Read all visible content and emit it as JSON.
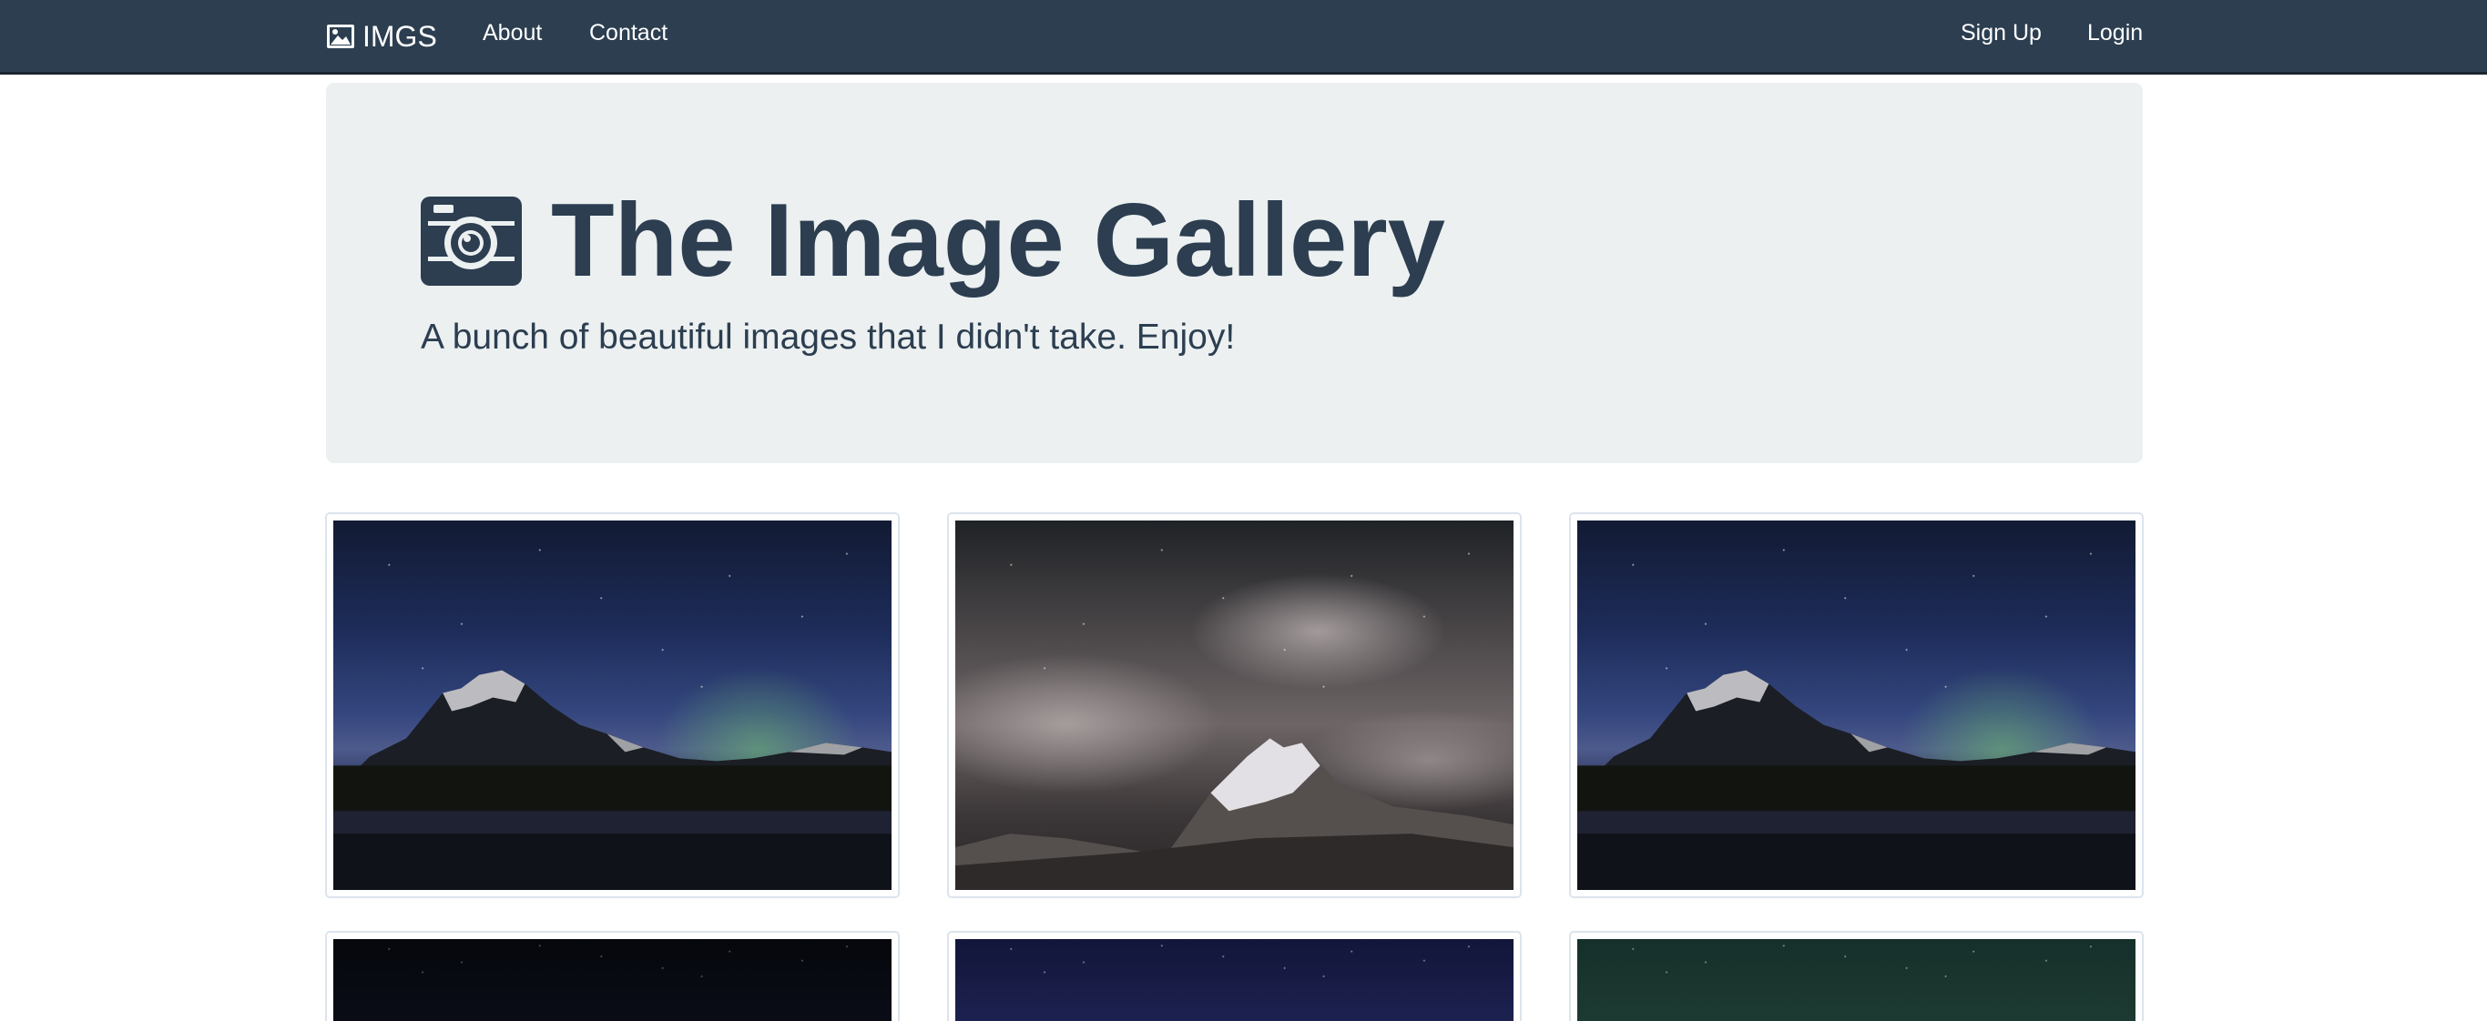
{
  "nav": {
    "brand": "IMGS",
    "brand_icon": "image-icon",
    "left_links": [
      "About",
      "Contact"
    ],
    "right_links": [
      "Sign Up",
      "Login"
    ],
    "colors": {
      "bar": "#2c3e50",
      "text": "#ffffff"
    }
  },
  "jumbotron": {
    "icon": "camera-icon",
    "title": "The Image Gallery",
    "subtitle": "A bunch of beautiful images that I didn't take. Enjoy!",
    "colors": {
      "background": "#ecf0f1",
      "text": "#2c3e50"
    }
  },
  "gallery": {
    "images": [
      {
        "scene": "mountain-lake-aurora-icon"
      },
      {
        "scene": "snowy-peak-cloudy-night-icon"
      },
      {
        "scene": "mountain-lake-aurora-icon"
      },
      {
        "scene": "dark-starry-sky-icon"
      },
      {
        "scene": "milky-way-night-icon"
      },
      {
        "scene": "green-starry-sky-icon"
      }
    ]
  }
}
